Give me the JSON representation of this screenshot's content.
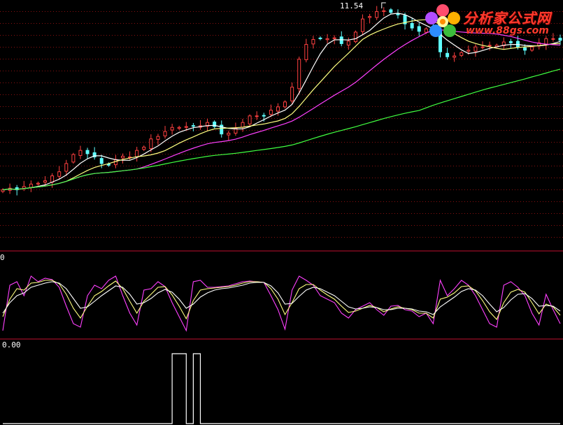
{
  "logo": {
    "brand": "分析家公式网",
    "url": "www.88gs.com"
  },
  "colors": {
    "up": "#ff4040",
    "down": "#60ffff",
    "ma_short": "#ffffff",
    "ma_mid": "#ffff80",
    "ma_long": "#ff40ff",
    "ma_longest": "#40ff40",
    "grid": "#8a1010",
    "divider": "#c01030",
    "osc_fast": "#ff40ff",
    "osc_mid": "#ffff80",
    "osc_slow": "#ffffff",
    "signal": "#ffffff"
  },
  "chart_data": [
    {
      "type": "candlestick",
      "panel": "price",
      "high_marker": "11.54",
      "series": [
        {
          "kind": "close",
          "values": [
            9.3,
            9.32,
            9.3,
            9.34,
            9.37,
            9.38,
            9.41,
            9.47,
            9.52,
            9.62,
            9.73,
            9.78,
            9.74,
            9.7,
            9.62,
            9.6,
            9.67,
            9.71,
            9.7,
            9.78,
            9.82,
            9.92,
            9.95,
            10.01,
            10.06,
            10.06,
            10.07,
            10.08,
            10.08,
            10.12,
            10.07,
            9.98,
            9.99,
            10.05,
            10.12,
            10.2,
            10.2,
            10.2,
            10.27,
            10.31,
            10.37,
            10.55,
            10.89,
            11.07,
            11.13,
            11.14,
            11.14,
            11.15,
            11.08,
            11.11,
            11.22,
            11.38,
            11.41,
            11.47,
            11.48,
            11.46,
            11.43,
            11.32,
            11.27,
            11.23,
            11.26,
            11.22,
            10.98,
            10.92,
            10.93,
            10.97,
            11.0,
            11.04,
            11.04,
            11.06,
            11.06,
            11.1,
            11.09,
            11.04,
            11.0,
            11.04,
            11.09,
            11.14,
            11.14,
            11.12
          ]
        },
        {
          "kind": "ma_short",
          "name": "MA5"
        },
        {
          "kind": "ma_mid",
          "name": "MA10"
        },
        {
          "kind": "ma_long",
          "name": "MA20"
        },
        {
          "kind": "ma_longest",
          "name": "MA60"
        }
      ]
    },
    {
      "type": "line",
      "panel": "oscillator",
      "top_label": "0",
      "ylim": [
        0,
        100
      ],
      "series": [
        {
          "name": "fast",
          "values": [
            10,
            75,
            80,
            60,
            88,
            80,
            85,
            83,
            72,
            45,
            20,
            15,
            60,
            75,
            70,
            82,
            88,
            60,
            35,
            18,
            68,
            70,
            80,
            73,
            50,
            30,
            10,
            80,
            82,
            72,
            72,
            73,
            74,
            77,
            80,
            81,
            80,
            79,
            60,
            40,
            12,
            68,
            88,
            82,
            75,
            60,
            55,
            50,
            35,
            28,
            40,
            45,
            50,
            40,
            32,
            45,
            46,
            40,
            38,
            30,
            35,
            20,
            82,
            60,
            70,
            82,
            75,
            60,
            40,
            20,
            15,
            75,
            80,
            72,
            60,
            35,
            18,
            62,
            40,
            20
          ]
        },
        {
          "name": "mid",
          "values": [
            30,
            55,
            70,
            68,
            78,
            79,
            82,
            82,
            77,
            62,
            42,
            28,
            45,
            60,
            66,
            74,
            81,
            70,
            52,
            35,
            52,
            62,
            72,
            73,
            61,
            45,
            27,
            53,
            68,
            70,
            71,
            72,
            73,
            75,
            78,
            80,
            80,
            79,
            70,
            55,
            33,
            50,
            70,
            76,
            76,
            68,
            61,
            55,
            45,
            36,
            38,
            42,
            46,
            43,
            37,
            41,
            44,
            42,
            40,
            35,
            35,
            28,
            55,
            58,
            64,
            73,
            74,
            67,
            53,
            37,
            26,
            50,
            65,
            69,
            65,
            50,
            34,
            48,
            44,
            32
          ]
        },
        {
          "name": "slow",
          "values": [
            35,
            50,
            60,
            64,
            72,
            75,
            78,
            80,
            78,
            70,
            56,
            42,
            44,
            52,
            60,
            67,
            74,
            72,
            62,
            48,
            50,
            56,
            64,
            69,
            65,
            55,
            42,
            48,
            58,
            64,
            68,
            70,
            71,
            73,
            75,
            78,
            79,
            79,
            74,
            64,
            48,
            49,
            59,
            68,
            72,
            70,
            65,
            60,
            52,
            44,
            41,
            42,
            44,
            43,
            40,
            40,
            42,
            42,
            41,
            38,
            37,
            33,
            44,
            51,
            58,
            66,
            70,
            68,
            60,
            48,
            37,
            43,
            54,
            62,
            63,
            56,
            45,
            46,
            45,
            38
          ]
        }
      ]
    },
    {
      "type": "line",
      "panel": "signal",
      "top_label": "0.00",
      "ylim": [
        0,
        1
      ],
      "series": [
        {
          "name": "signal",
          "values": [
            0,
            0,
            0,
            0,
            0,
            0,
            0,
            0,
            0,
            0,
            0,
            0,
            0,
            0,
            0,
            0,
            0,
            0,
            0,
            0,
            0,
            0,
            0,
            0,
            1,
            1,
            0,
            1,
            0,
            0,
            0,
            0,
            0,
            0,
            0,
            0,
            0,
            0,
            0,
            0,
            0,
            0,
            0,
            0,
            0,
            0,
            0,
            0,
            0,
            0,
            0,
            0,
            0,
            0,
            0,
            0,
            0,
            0,
            0,
            0,
            0,
            0,
            0,
            0,
            0,
            0,
            0,
            0,
            0,
            0,
            0,
            0,
            0,
            0,
            0,
            0,
            0,
            0,
            0,
            0
          ]
        }
      ]
    }
  ]
}
